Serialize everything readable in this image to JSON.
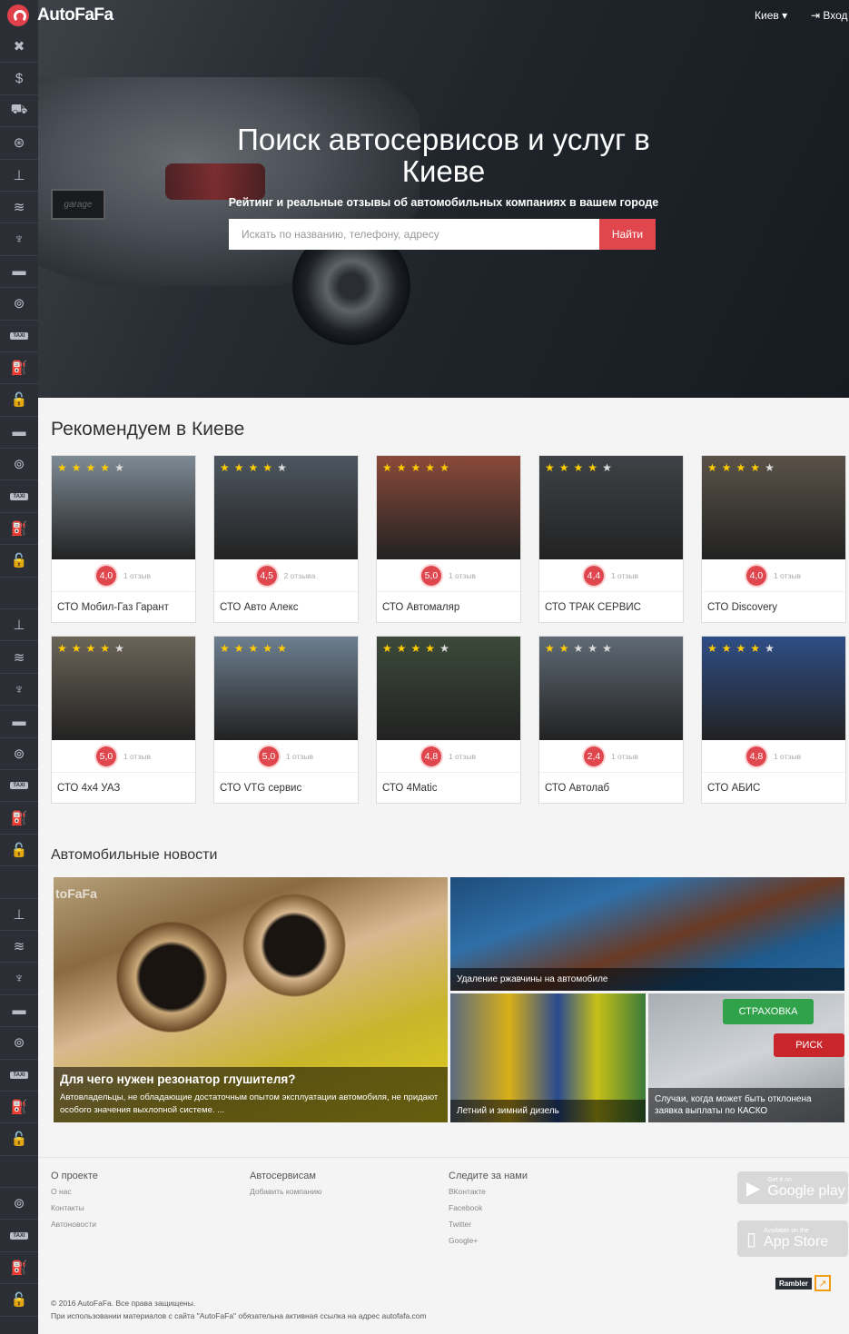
{
  "header": {
    "logo": "AutoFaFa",
    "city": "Киев ▾",
    "login": "Вход"
  },
  "hero": {
    "title": "Поиск автосервисов и услуг в Киеве",
    "subtitle": "Рейтинг и реальные отзывы об автомобильных компаниях в вашем городе",
    "plate_text": "garage",
    "search_placeholder": "Искать по названию, телефону, адресу",
    "search_button": "Найти"
  },
  "recommended": {
    "title": "Рекомендуем в Киеве",
    "cards": [
      {
        "name": "СТО Мобил-Газ Гарант",
        "rating": "4,0",
        "reviews": "1 отзыв",
        "stars": 4,
        "img_color": "#7d8a95"
      },
      {
        "name": "СТО Авто Алекс",
        "rating": "4,5",
        "reviews": "2 отзыва",
        "stars": 4,
        "img_color": "#4d5660"
      },
      {
        "name": "СТО Автомаляр",
        "rating": "5,0",
        "reviews": "1 отзыв",
        "stars": 5,
        "img_color": "#8a4a3a"
      },
      {
        "name": "СТО ТРАК СЕРВИС",
        "rating": "4,4",
        "reviews": "1 отзыв",
        "stars": 4,
        "img_color": "#3e4246"
      },
      {
        "name": "СТО Discovery",
        "rating": "4,0",
        "reviews": "1 отзыв",
        "stars": 4,
        "img_color": "#5a5248"
      },
      {
        "name": "СТО 4x4 УАЗ",
        "rating": "5,0",
        "reviews": "1 отзыв",
        "stars": 4,
        "img_color": "#6b6458"
      },
      {
        "name": "СТО VTG сервис",
        "rating": "5,0",
        "reviews": "1 отзыв",
        "stars": 5,
        "img_color": "#6d7f90"
      },
      {
        "name": "СТО 4Matic",
        "rating": "4,8",
        "reviews": "1 отзыв",
        "stars": 4,
        "img_color": "#3c4a3a"
      },
      {
        "name": "СТО Автолаб",
        "rating": "2,4",
        "reviews": "1 отзыв",
        "stars": 2,
        "img_color": "#5f6a74"
      },
      {
        "name": "СТО АБИС",
        "rating": "4,8",
        "reviews": "1 отзыв",
        "stars": 4,
        "img_color": "#2f4e86"
      }
    ]
  },
  "news": {
    "title": "Автомобильные новости",
    "items": [
      {
        "title": "Для чего нужен резонатор глушителя?",
        "desc": "Автовладельцы, не обладающие достаточным опытом эксплуатации автомобиля, не придают особого значения выхлопной системе. ...",
        "watermark": "toFaFa"
      },
      {
        "title": "Удаление ржавчины на автомобиле"
      },
      {
        "title": "Летний и зимний дизель"
      },
      {
        "title": "Случаи, когда может быть отклонена заявка выплаты по КАСКО",
        "sign1": "СТРАХОВКА",
        "sign2": "РИСК"
      }
    ]
  },
  "footer": {
    "col1": {
      "head": "О проекте",
      "links": [
        "О нас",
        "Контакты",
        "Автоновости"
      ]
    },
    "col2": {
      "head": "Автосервисам",
      "links": [
        "Добавить компанию"
      ]
    },
    "col3": {
      "head": "Следите за нами",
      "links": [
        "ВКонтакте",
        "Facebook",
        "Twitter",
        "Google+"
      ]
    },
    "google": {
      "small": "Get it on",
      "big": "Google play"
    },
    "apple": {
      "small": "Available on the",
      "big": "App Store"
    },
    "rambler": "Rambler",
    "copyright": "© 2016 AutoFaFa. Все права защищены.",
    "notice": "При использовании материалов с сайта \"AutoFaFa\" обязательна активная ссылка на адрес autofafa.com"
  },
  "sidebar": {
    "icons": [
      "tools-icon",
      "dollar-icon",
      "tow-truck-icon",
      "wheel-icon",
      "lift-icon",
      "car-wash-icon",
      "spark-plug-icon",
      "car-icon",
      "steering-wheel-icon",
      "taxi-icon",
      "fuel-icon",
      "lock-icon",
      "car-icon",
      "steering-wheel-icon",
      "taxi-icon",
      "fuel-icon",
      "lock-icon",
      "blank",
      "lift-icon",
      "car-wash-icon",
      "spark-plug-icon",
      "car-icon",
      "steering-wheel-icon",
      "taxi-icon",
      "fuel-icon",
      "lock-icon",
      "blank",
      "lift-icon",
      "car-wash-icon",
      "spark-plug-icon",
      "car-icon",
      "steering-wheel-icon",
      "taxi-icon",
      "fuel-icon",
      "lock-icon",
      "blank",
      "steering-wheel-icon",
      "taxi-icon",
      "fuel-icon",
      "lock-icon"
    ]
  },
  "colors": {
    "accent": "#e0464d",
    "sidebar": "#2b2e35",
    "star": "#ffcc00"
  }
}
